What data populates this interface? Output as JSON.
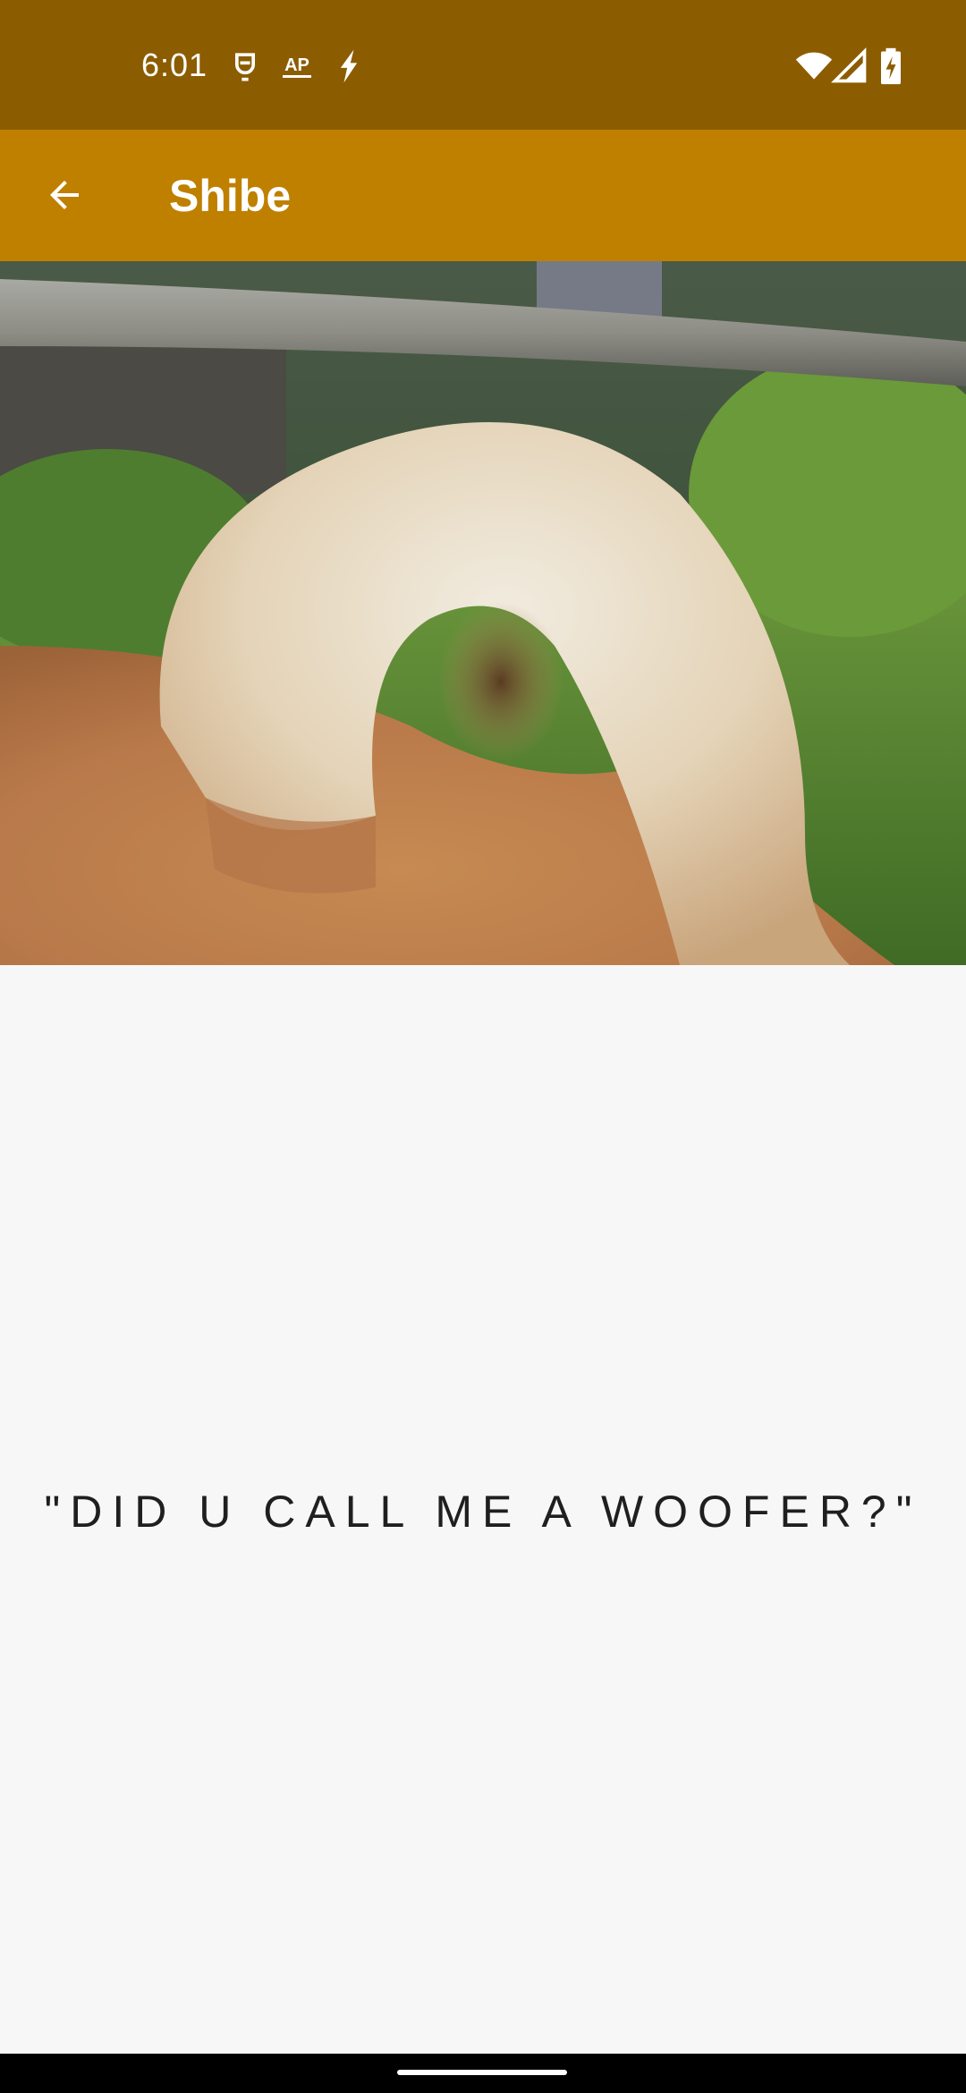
{
  "status_bar": {
    "time": "6:01",
    "left_icons": [
      "app-notification-icon",
      "ap-news-icon",
      "flash-icon"
    ],
    "ap_label": "AP",
    "right_icons": [
      "wifi-icon",
      "cellular-signal-icon",
      "battery-charging-icon"
    ],
    "background_color": "#8c5c00"
  },
  "app_bar": {
    "title": "Shibe",
    "back_icon": "arrow-back-icon",
    "background_color": "#bf8000"
  },
  "content": {
    "quote": "\"DID U CALL ME A WOOFER?\"",
    "background_color": "#f7f7f7"
  }
}
